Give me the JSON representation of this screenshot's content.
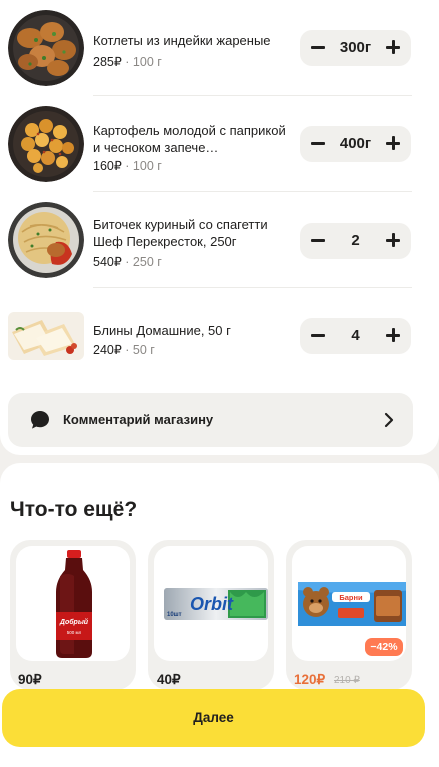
{
  "cart": {
    "items": [
      {
        "name": "Котлеты из индейки жареные",
        "price": "285₽",
        "per": " · 100 г",
        "qty": "300г",
        "image": "turkey-cutlets"
      },
      {
        "name": "Картофель молодой с паприкой и чесноком запече…",
        "price": "160₽",
        "per": " · 100 г",
        "qty": "400г",
        "image": "baked-potatoes"
      },
      {
        "name": "Биточек куриный со спагетти Шеф Перекресток, 250г",
        "price": "540₽",
        "per": " · 250 г",
        "qty": "2",
        "image": "chicken-spaghetti"
      },
      {
        "name": "Блины Домашние, 50 г",
        "price": "240₽",
        "per": " · 50 г",
        "qty": "4",
        "image": "pancakes"
      }
    ]
  },
  "comment": {
    "label": "Комментарий магазину",
    "icon": "chat-bubble-icon"
  },
  "more": {
    "title": "Что-то ещё?",
    "products": [
      {
        "image": "cola-bottle",
        "price": "90₽",
        "bottle_label": "Добрый",
        "bottle_sub": "500 мл"
      },
      {
        "image": "orbit-gum",
        "price": "40₽",
        "brand": "Orbit",
        "pack_count": "10шт"
      },
      {
        "image": "barni-cookies",
        "price": "120₽",
        "old_price": "210 ₽",
        "discount": "−42%",
        "brand": "Барни"
      }
    ]
  },
  "footer": {
    "next_label": "Далее"
  },
  "colors": {
    "accent": "#fbde37",
    "sale": "#e8703a",
    "badge": "#ff7a52"
  }
}
